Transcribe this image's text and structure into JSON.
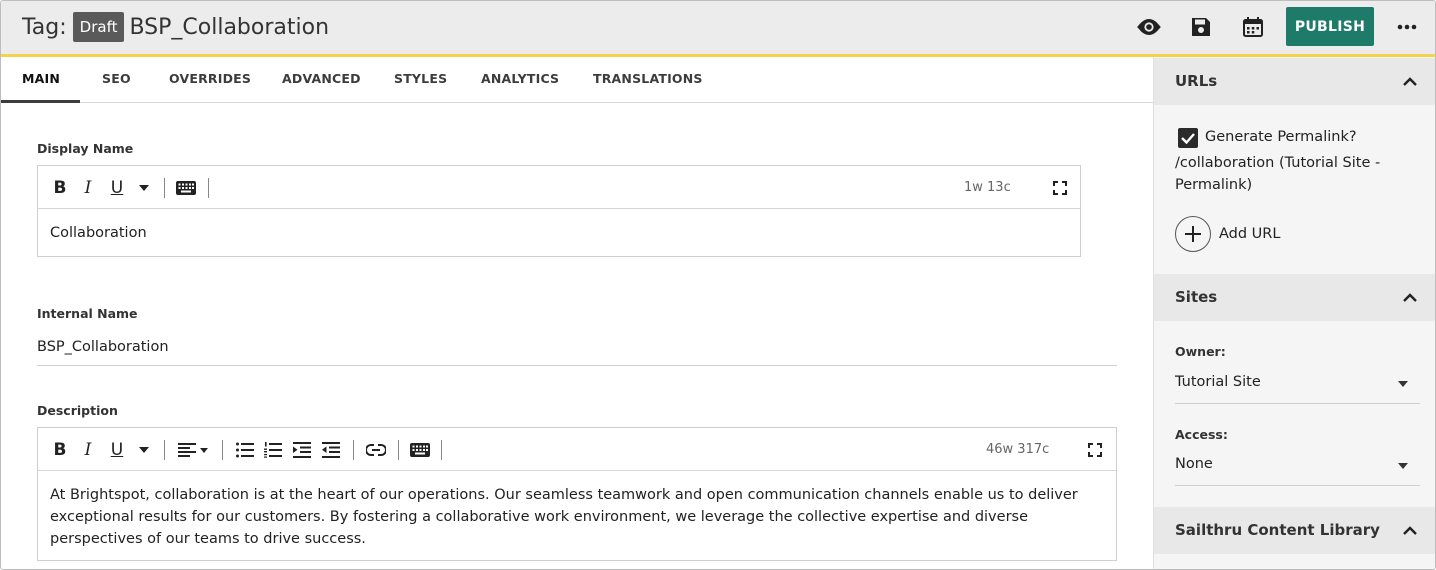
{
  "header": {
    "prefix": "Tag:",
    "status_badge": "Draft",
    "title": "BSP_Collaboration",
    "publish_label": "PUBLISH"
  },
  "tabs": [
    {
      "label": "MAIN",
      "active": true
    },
    {
      "label": "SEO"
    },
    {
      "label": "OVERRIDES"
    },
    {
      "label": "ADVANCED"
    },
    {
      "label": "STYLES"
    },
    {
      "label": "ANALYTICS"
    },
    {
      "label": "TRANSLATIONS"
    }
  ],
  "main": {
    "display_name": {
      "label": "Display Name",
      "value": "Collaboration",
      "count": "1w 13c",
      "toolbar": {
        "bold": "B",
        "italic": "I",
        "underline": "U"
      }
    },
    "internal_name": {
      "label": "Internal Name",
      "value": "BSP_Collaboration"
    },
    "description": {
      "label": "Description",
      "count": "46w 317c",
      "value": "At Brightspot, collaboration is at the heart of our operations. Our seamless teamwork and open communication channels enable us to deliver exceptional results for our customers. By fostering a collaborative work environment, we leverage the collective expertise and diverse perspectives of our teams to drive success.",
      "toolbar": {
        "bold": "B",
        "italic": "I",
        "underline": "U"
      }
    }
  },
  "sidebar": {
    "urls": {
      "title": "URLs",
      "generate_permalink_label": "Generate Permalink?",
      "permalink_checked": true,
      "permalink_value": "/collaboration (Tutorial Site - Permalink)",
      "add_url_label": "Add URL"
    },
    "sites": {
      "title": "Sites",
      "owner_label": "Owner:",
      "owner_value": "Tutorial Site",
      "access_label": "Access:",
      "access_value": "None"
    },
    "sailthru": {
      "title": "Sailthru Content Library"
    }
  },
  "colors": {
    "accent_publish": "#1e7b6a",
    "header_underline": "#f3d34a",
    "badge_bg": "#5a5a5a"
  }
}
